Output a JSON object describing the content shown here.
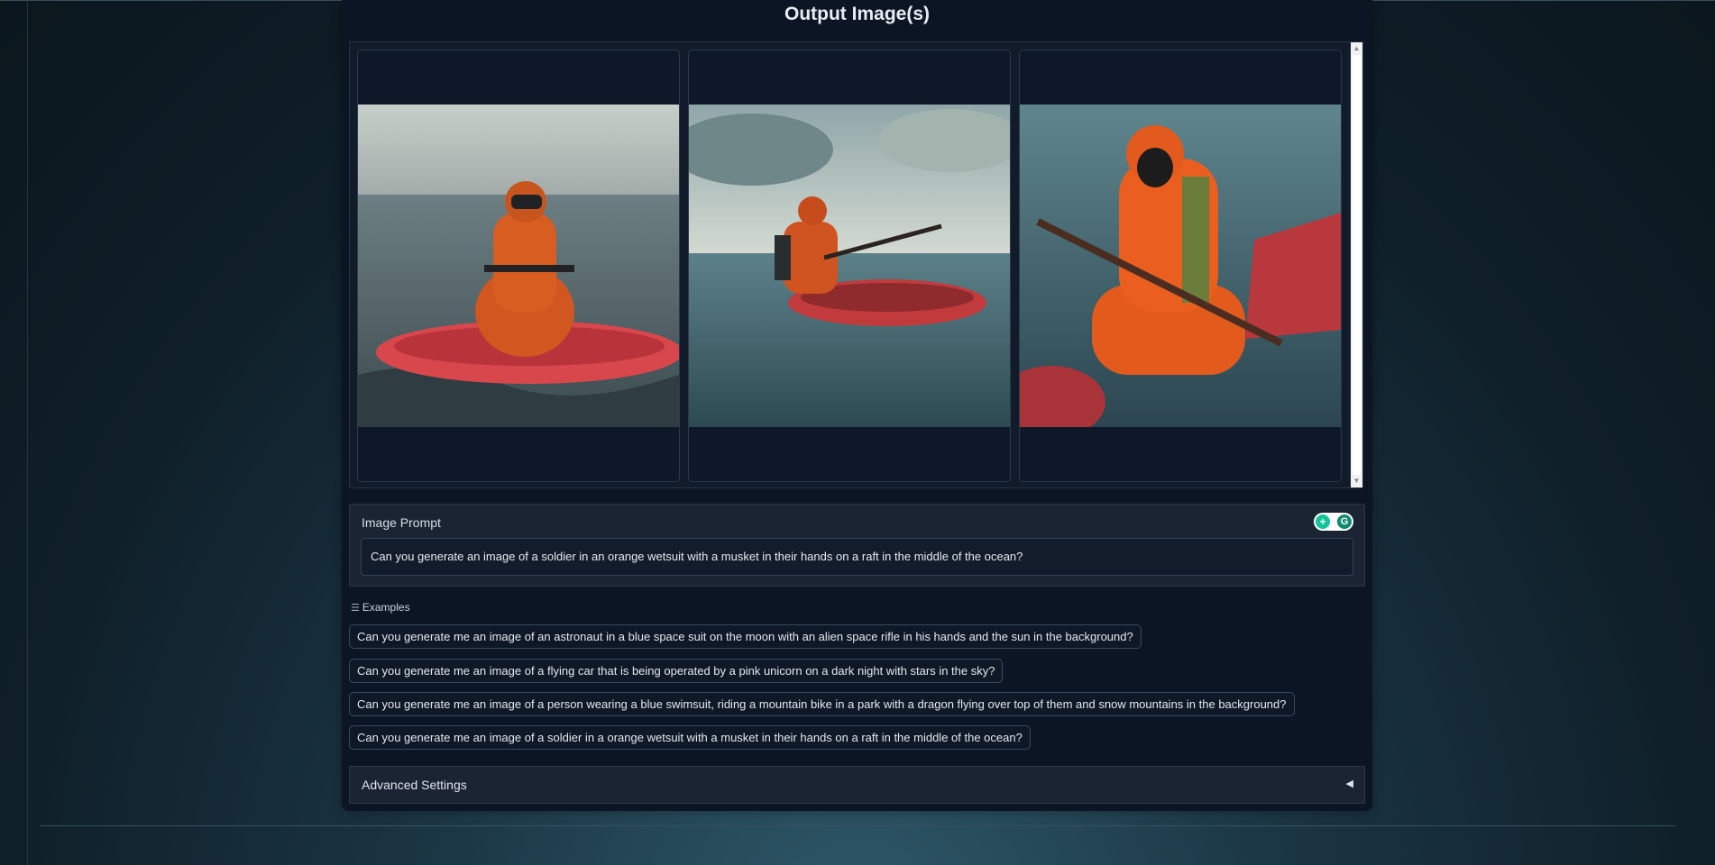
{
  "output": {
    "title": "Output Image(s)",
    "images": [
      {
        "alt": "soldier in orange wetsuit on red raft, helmet and goggles, gray sea"
      },
      {
        "alt": "soldier in orange wetsuit with musket on red inflatable raft"
      },
      {
        "alt": "person in orange hooded wetsuit with gas mask holding musket in water"
      }
    ]
  },
  "prompt": {
    "label": "Image Prompt",
    "value": "Can you generate an image of a soldier in an orange wetsuit with a musket in their hands on a raft in the middle of the ocean?"
  },
  "examples": {
    "label": "Examples",
    "items": [
      "Can you generate me an image of an astronaut in a blue space suit on the moon with an alien space rifle in his hands and the sun in the background?",
      "Can you generate me an image of a flying car that is being operated by a pink unicorn on a dark night with stars in the sky?",
      "Can you generate me an image of a person wearing a blue swimsuit, riding a mountain bike in a park with a dragon flying over top of them and snow mountains in the background?",
      "Can you generate me an image of a soldier in a orange wetsuit with a musket in their hands on a raft in the middle of the ocean?"
    ]
  },
  "advanced": {
    "label": "Advanced Settings",
    "caret": "◀"
  },
  "icons": {
    "examples": "list-icon",
    "grammar": "grammarly-icon",
    "collapse": "caret-left-icon"
  },
  "colors": {
    "panel": "#0c1523",
    "accent": "#15c39a"
  }
}
